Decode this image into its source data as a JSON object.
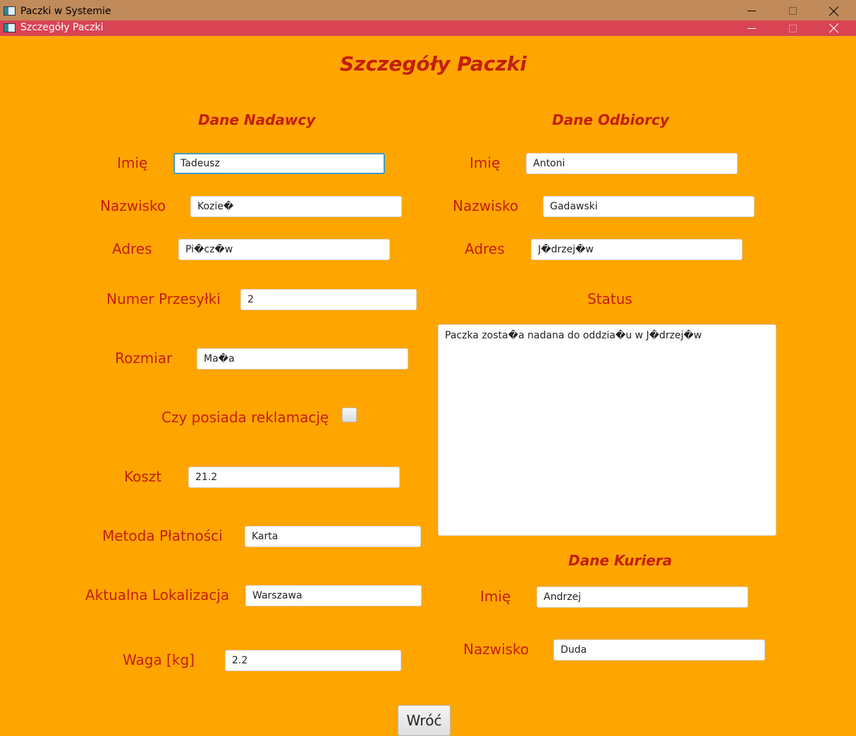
{
  "windows": {
    "back_title": "Paczki w Systemie",
    "front_title": "Szczegóły Paczki"
  },
  "page_title": "Szczegóły Paczki",
  "sender": {
    "heading": "Dane Nadawcy",
    "first_name_label": "Imię",
    "first_name": "Tadeusz",
    "last_name_label": "Nazwisko",
    "last_name": "Kozie�",
    "address_label": "Adres",
    "address": "Pi�cz�w"
  },
  "recipient": {
    "heading": "Dane Odbiorcy",
    "first_name_label": "Imię",
    "first_name": "Antoni",
    "last_name_label": "Nazwisko",
    "last_name": "Gadawski",
    "address_label": "Adres",
    "address": "J�drzej�w"
  },
  "package": {
    "number_label": "Numer Przesyłki",
    "number": "2",
    "size_label": "Rozmiar",
    "size": "Ma�a",
    "complaint_label": "Czy posiada reklamację",
    "has_complaint": false,
    "cost_label": "Koszt",
    "cost": "21.2",
    "payment_label": "Metoda Płatności",
    "payment": "Karta",
    "location_label": "Aktualna Lokalizacja",
    "location": "Warszawa",
    "weight_label": "Waga [kg]",
    "weight": "2.2",
    "status_label": "Status",
    "status": "Paczka zosta�a nadana do oddzia�u w J�drzej�w"
  },
  "courier": {
    "heading": "Dane Kuriera",
    "first_name_label": "Imię",
    "first_name": "Andrzej",
    "last_name_label": "Nazwisko",
    "last_name": "Duda"
  },
  "back_button": "Wróć",
  "colors": {
    "background": "#ffa500",
    "label_text": "#c41e0e",
    "back_titlebar": "#c08a5a",
    "front_titlebar": "#d94454"
  }
}
